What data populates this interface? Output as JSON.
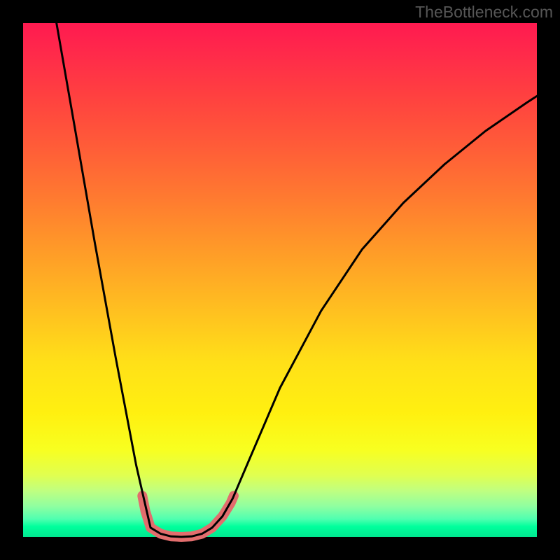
{
  "watermark": "TheBottleneck.com",
  "chart_data": {
    "type": "line",
    "title": "",
    "xlabel": "",
    "ylabel": "",
    "xlim": [
      0,
      1
    ],
    "ylim": [
      0,
      1
    ],
    "legend": false,
    "grid": false,
    "background_gradient": {
      "top": "#ff1a50",
      "upper_mid": "#ff7a30",
      "mid": "#ffe018",
      "lower_mid": "#f8ff20",
      "bottom": "#00ff9c"
    },
    "series": [
      {
        "name": "main-curve",
        "color": "#000000",
        "width": 2.5,
        "x": [
          0.065,
          0.1,
          0.14,
          0.18,
          0.22,
          0.248,
          0.268,
          0.288,
          0.308,
          0.328,
          0.348,
          0.368,
          0.388,
          0.408,
          0.44,
          0.5,
          0.58,
          0.66,
          0.74,
          0.82,
          0.9,
          0.98,
          1.0
        ],
        "y": [
          1.0,
          0.8,
          0.57,
          0.35,
          0.14,
          0.018,
          0.006,
          0.001,
          0.0,
          0.001,
          0.006,
          0.018,
          0.04,
          0.075,
          0.15,
          0.29,
          0.44,
          0.56,
          0.65,
          0.725,
          0.79,
          0.845,
          0.858
        ]
      },
      {
        "name": "red-band",
        "color": "#e26d6d",
        "width": 13,
        "x": [
          0.232,
          0.238,
          0.248,
          0.268,
          0.288,
          0.308,
          0.328,
          0.348,
          0.368,
          0.388,
          0.404,
          0.41
        ],
        "y": [
          0.08,
          0.05,
          0.018,
          0.006,
          0.001,
          0.0,
          0.001,
          0.006,
          0.018,
          0.04,
          0.066,
          0.08
        ]
      }
    ]
  }
}
